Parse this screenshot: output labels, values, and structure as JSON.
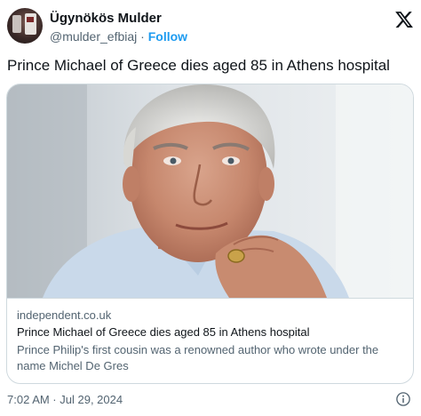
{
  "author": {
    "display_name": "Ügynökös Mulder",
    "handle": "@mulder_efbiaj",
    "separator": "·",
    "follow_label": "Follow"
  },
  "platform_icon": "x-logo-icon",
  "tweet": {
    "text": "Prince Michael of Greece dies aged 85 in Athens hospital"
  },
  "link_card": {
    "domain": "independent.co.uk",
    "title": "Prince Michael of Greece dies aged 85 in Athens hospital",
    "description": "Prince Philip's first cousin was a renowned author who wrote under the name Michel De Gres"
  },
  "meta": {
    "timestamp": "7:02 AM · Jul 29, 2024"
  },
  "icons": {
    "info": "info-icon"
  }
}
